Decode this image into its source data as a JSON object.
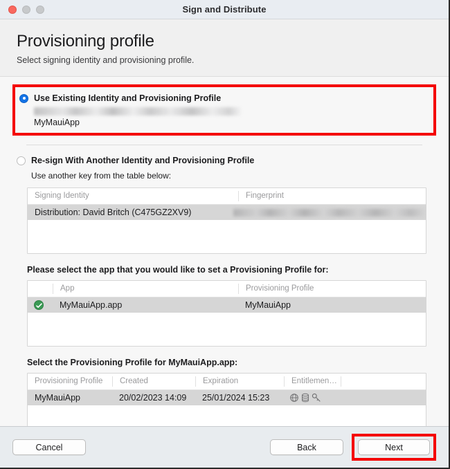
{
  "window": {
    "title": "Sign and Distribute",
    "traffic_lights": [
      "close",
      "minimize",
      "maximize"
    ]
  },
  "header": {
    "title": "Provisioning profile",
    "subtitle": "Select signing identity and provisioning profile."
  },
  "options": {
    "existing": {
      "label": "Use Existing Identity and Provisioning Profile",
      "redacted_identity": "",
      "profile_name": "MyMauiApp",
      "selected": true,
      "highlight_color": "#f40000"
    },
    "resign": {
      "label": "Re-sign With Another Identity and Provisioning Profile",
      "hint": "Use another key from the table below:",
      "selected": false
    }
  },
  "identity_table": {
    "columns": [
      "Signing Identity",
      "Fingerprint"
    ],
    "rows": [
      {
        "signing_identity": "Distribution: David Britch (C475GZ2XV9)",
        "fingerprint": "",
        "selected": true
      }
    ]
  },
  "app_section": {
    "label": "Please select the app that you would like to set a Provisioning Profile for:",
    "columns": [
      "",
      "App",
      "Provisioning Profile"
    ],
    "rows": [
      {
        "checked": true,
        "app": "MyMauiApp.app",
        "provisioning_profile": "MyMauiApp",
        "selected": true
      }
    ]
  },
  "profile_section": {
    "label": "Select the Provisioning Profile for MyMauiApp.app:",
    "columns": [
      "Provisioning Profile",
      "Created",
      "Expiration",
      "Entitlemen…",
      ""
    ],
    "rows": [
      {
        "provisioning_profile": "MyMauiApp",
        "created": "20/02/2023 14:09",
        "expiration": "25/01/2024 15:23",
        "entitlement_icons": [
          "network-icon",
          "database-icon",
          "key-icon"
        ],
        "selected": true
      }
    ]
  },
  "footer": {
    "cancel_label": "Cancel",
    "back_label": "Back",
    "next_label": "Next",
    "next_highlight_color": "#f40000"
  }
}
